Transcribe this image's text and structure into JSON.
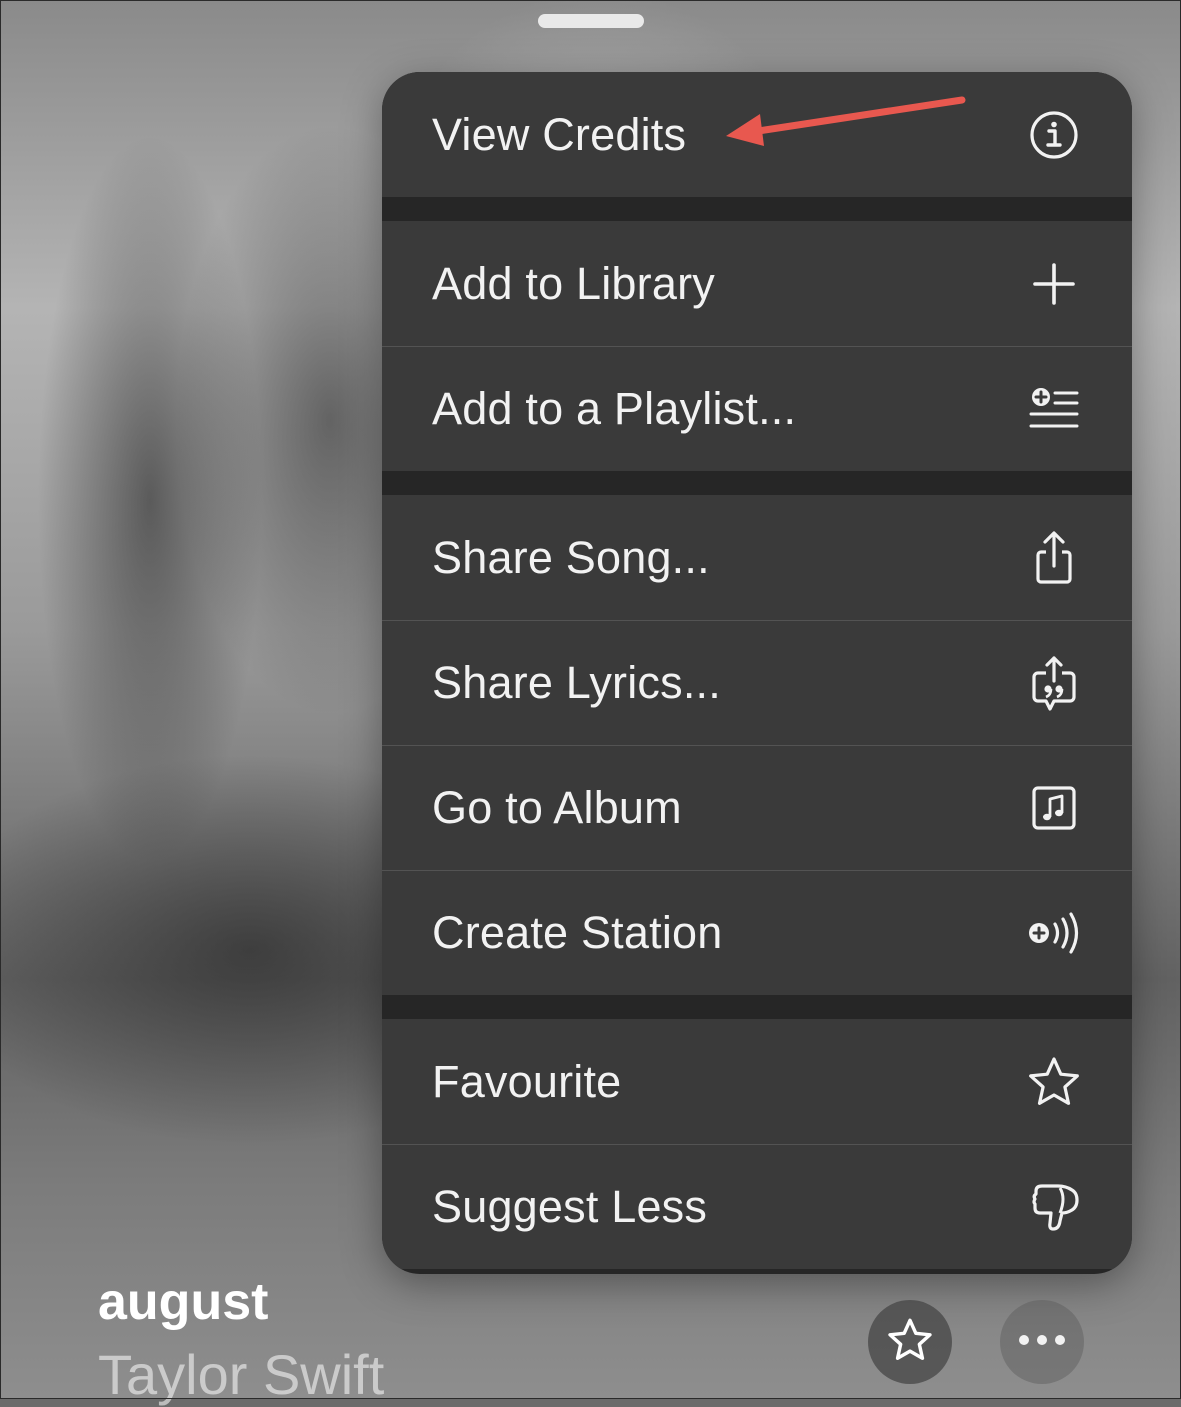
{
  "menu": {
    "items": [
      {
        "label": "View Credits",
        "icon": "info-icon"
      },
      {
        "label": "Add to Library",
        "icon": "plus-icon"
      },
      {
        "label": "Add to a Playlist...",
        "icon": "add-to-playlist-icon"
      },
      {
        "label": "Share Song...",
        "icon": "share-icon"
      },
      {
        "label": "Share Lyrics...",
        "icon": "share-lyrics-icon"
      },
      {
        "label": "Go to Album",
        "icon": "album-icon"
      },
      {
        "label": "Create Station",
        "icon": "create-station-icon"
      },
      {
        "label": "Favourite",
        "icon": "star-icon"
      },
      {
        "label": "Suggest Less",
        "icon": "thumbs-down-icon"
      }
    ]
  },
  "now_playing": {
    "title": "august",
    "artist": "Taylor Swift"
  },
  "controls": {
    "favourite_icon": "star-icon",
    "more_icon": "ellipsis-icon"
  },
  "colors": {
    "menu_background": "#3a3a3a",
    "menu_separator": "#262626",
    "text": "#f2f2f2",
    "annotation_arrow": "#e8584f"
  }
}
